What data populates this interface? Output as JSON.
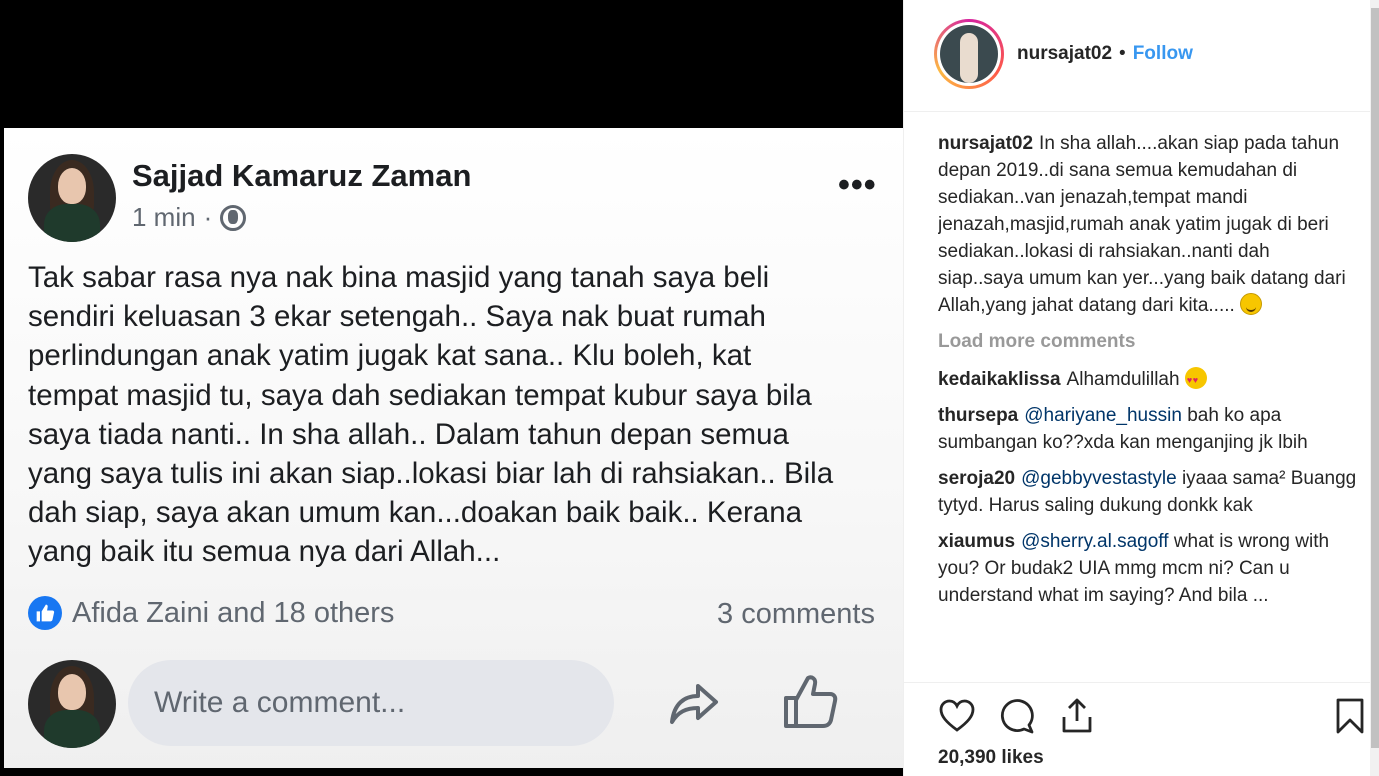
{
  "post": {
    "author": "Sajjad Kamaruz Zaman",
    "time": "1 min",
    "separator": "·",
    "more": "•••",
    "text": "Tak sabar rasa nya nak bina masjid yang tanah saya beli\nsendiri keluasan 3 ekar setengah.. Saya nak buat rumah\nperlindungan anak yatim jugak kat sana.. Klu boleh, kat\ntempat masjid tu, saya dah sediakan tempat kubur saya bila\nsaya tiada nanti.. In sha allah.. Dalam tahun depan semua\nyang saya tulis ini akan siap..lokasi biar lah di rahsiakan.. Bila\ndah siap, saya akan umum kan...doakan baik baik.. Kerana\nyang baik itu semua nya dari Allah...",
    "reactions": "Afida Zaini and 18 others",
    "comments_count": "3 comments",
    "comment_placeholder": "Write a comment..."
  },
  "instagram": {
    "username": "nursajat02",
    "dot": "•",
    "follow_label": "Follow",
    "caption_user": "nursajat02",
    "caption": "In sha allah....akan siap pada tahun depan 2019..di sana semua kemudahan di sediakan..van jenazah,tempat mandi jenazah,masjid,rumah anak yatim jugak di beri sediakan..lokasi di rahsiakan..nanti dah siap..saya umum kan yer...yang baik datang dari Allah,yang jahat datang dari kita.....",
    "load_more": "Load more comments",
    "comments": [
      {
        "user": "kedaikaklissa",
        "mention": "",
        "text": "Alhamdulillah"
      },
      {
        "user": "thursepa",
        "mention": "@hariyane_hussin",
        "text": "bah ko apa sumbangan ko??xda kan menganjing jk lbih"
      },
      {
        "user": "seroja20",
        "mention": "@gebbyvestastyle",
        "text": "iyaaa sama² Buangg tytyd. Harus saling dukung donkk kak"
      },
      {
        "user": "xiaumus",
        "mention": "@sherry.al.sagoff",
        "text": "what is wrong with you? Or budak2 UIA mmg mcm ni? Can u understand what im saying? And bila ..."
      }
    ],
    "likes": "20,390 likes"
  },
  "colors": {
    "link": "#3897f0",
    "mention": "#003569",
    "fb_blue": "#1877f2"
  }
}
